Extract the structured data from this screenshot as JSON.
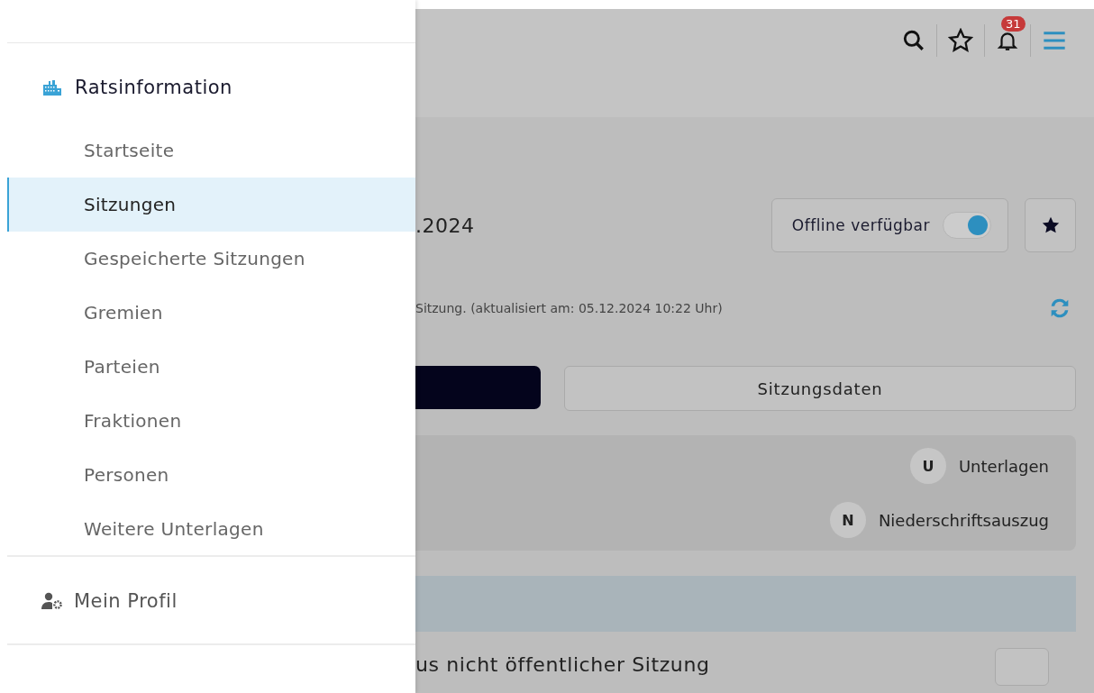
{
  "nav": {
    "section": {
      "title": "Ratsinformation"
    },
    "items": [
      {
        "label": "Startseite",
        "selected": false
      },
      {
        "label": "Sitzungen",
        "selected": true
      },
      {
        "label": "Gespeicherte Sitzungen",
        "selected": false
      },
      {
        "label": "Gremien",
        "selected": false
      },
      {
        "label": "Parteien",
        "selected": false
      },
      {
        "label": "Fraktionen",
        "selected": false
      },
      {
        "label": "Personen",
        "selected": false
      },
      {
        "label": "Weitere Unterlagen",
        "selected": false
      }
    ],
    "profile": {
      "label": "Mein Profil"
    }
  },
  "header": {
    "notification_count": "31"
  },
  "meeting": {
    "title": ".2024",
    "offline": {
      "label": "Offline verfügbar",
      "on": true
    },
    "info": "Sitzung. (aktualisiert am: 05.12.2024 10:22 Uhr)",
    "tabs": [
      {
        "label": "Sitzungsdaten",
        "selected": false
      }
    ],
    "legend": [
      {
        "letter": "U",
        "label": "Unterlagen"
      },
      {
        "letter": "N",
        "label": "Niederschriftsauszug"
      }
    ],
    "agenda_row": "us nicht öffentlicher Sitzung"
  }
}
